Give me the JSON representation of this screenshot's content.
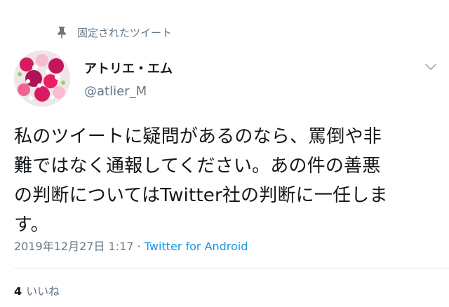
{
  "pinned": {
    "icon": "pin-icon",
    "label": "固定されたツイート"
  },
  "author": {
    "avatar": "flower-bouquet-avatar",
    "display_name": "アトリエ・エム",
    "handle": "@atlier_M"
  },
  "menu": {
    "icon": "chevron-down-icon"
  },
  "tweet": {
    "lines": [
      "私のツイートに疑問があるのなら、罵倒や非",
      "難ではなく通報してください。あの件の善悪",
      "の判断についてはTwitter社の判断に一任しま",
      "す。"
    ]
  },
  "meta": {
    "timestamp": "2019年12月27日 1:17",
    "separator": " · ",
    "source": "Twitter for Android"
  },
  "stats": {
    "likes_count": "4",
    "likes_label": "いいね"
  },
  "colors": {
    "accent": "#1b95e0",
    "secondary_text": "#657786",
    "primary_text": "#14171a"
  }
}
